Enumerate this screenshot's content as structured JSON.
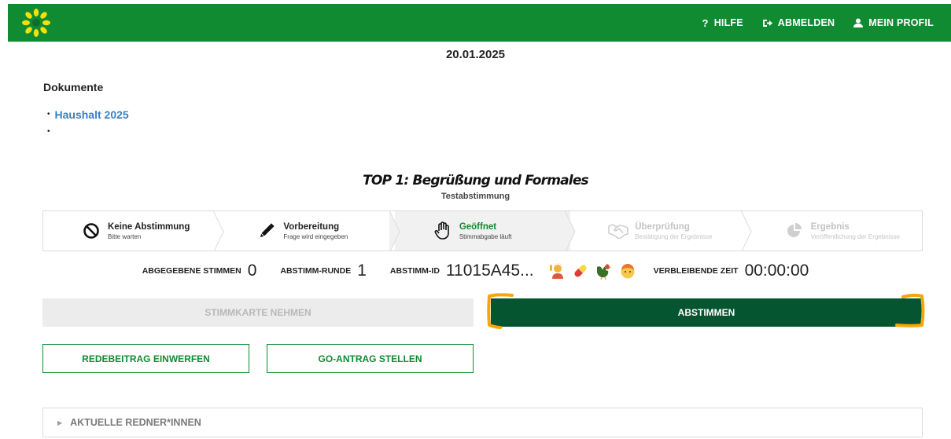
{
  "colors": {
    "brand_green": "#118b32",
    "dark_green": "#055531",
    "link_blue": "#3a7fc3",
    "highlight": "#f5a60a"
  },
  "header": {
    "logo_icon": "sunflower-icon",
    "nav": [
      {
        "label": "HILFE",
        "icon": "question-icon"
      },
      {
        "label": "ABMELDEN",
        "icon": "logout-icon"
      },
      {
        "label": "MEIN PROFIL",
        "icon": "user-icon"
      }
    ]
  },
  "date": "20.01.2025",
  "documents": {
    "title": "Dokumente",
    "items": [
      {
        "label": "Haushalt 2025"
      },
      {
        "label": ""
      }
    ]
  },
  "agenda": {
    "title": "TOP 1: Begrüßung und Formales",
    "subtitle": "Testabstimmung"
  },
  "steps": [
    {
      "title": "Keine Abstimmung",
      "sub": "Bitte warten",
      "icon": "no-entry-icon",
      "state": "done"
    },
    {
      "title": "Vorbereitung",
      "sub": "Frage wird eingegeben",
      "icon": "pencil-icon",
      "state": "done"
    },
    {
      "title": "Geöffnet",
      "sub": "Stimmabgabe läuft",
      "icon": "hand-icon",
      "state": "active"
    },
    {
      "title": "Überprüfung",
      "sub": "Bestätigung der Ergebnisse",
      "icon": "handshake-icon",
      "state": "disabled"
    },
    {
      "title": "Ergebnis",
      "sub": "Veröffentlichung der Ergebnisse",
      "icon": "pie-chart-icon",
      "state": "disabled"
    }
  ],
  "stats": {
    "votes_label": "ABGEGEBENE STIMMEN",
    "votes_value": "0",
    "round_label": "ABSTIMM-RUNDE",
    "round_value": "1",
    "id_label": "ABSTIMM-ID",
    "id_value": "11015A45...",
    "emojis": [
      "person-raising-hand-icon",
      "pill-icon",
      "rooster-icon",
      "face-icon"
    ],
    "time_label": "VERBLEIBENDE ZEIT",
    "time_value": "00:00:00"
  },
  "buttons": {
    "take_card": "STIMMKARTE NEHMEN",
    "vote": "ABSTIMMEN",
    "speech": "REDEBEITRAG EINWERFEN",
    "motion": "GO-ANTRAG STELLEN"
  },
  "speakers": {
    "label": "AKTUELLE REDNER*INNEN"
  }
}
